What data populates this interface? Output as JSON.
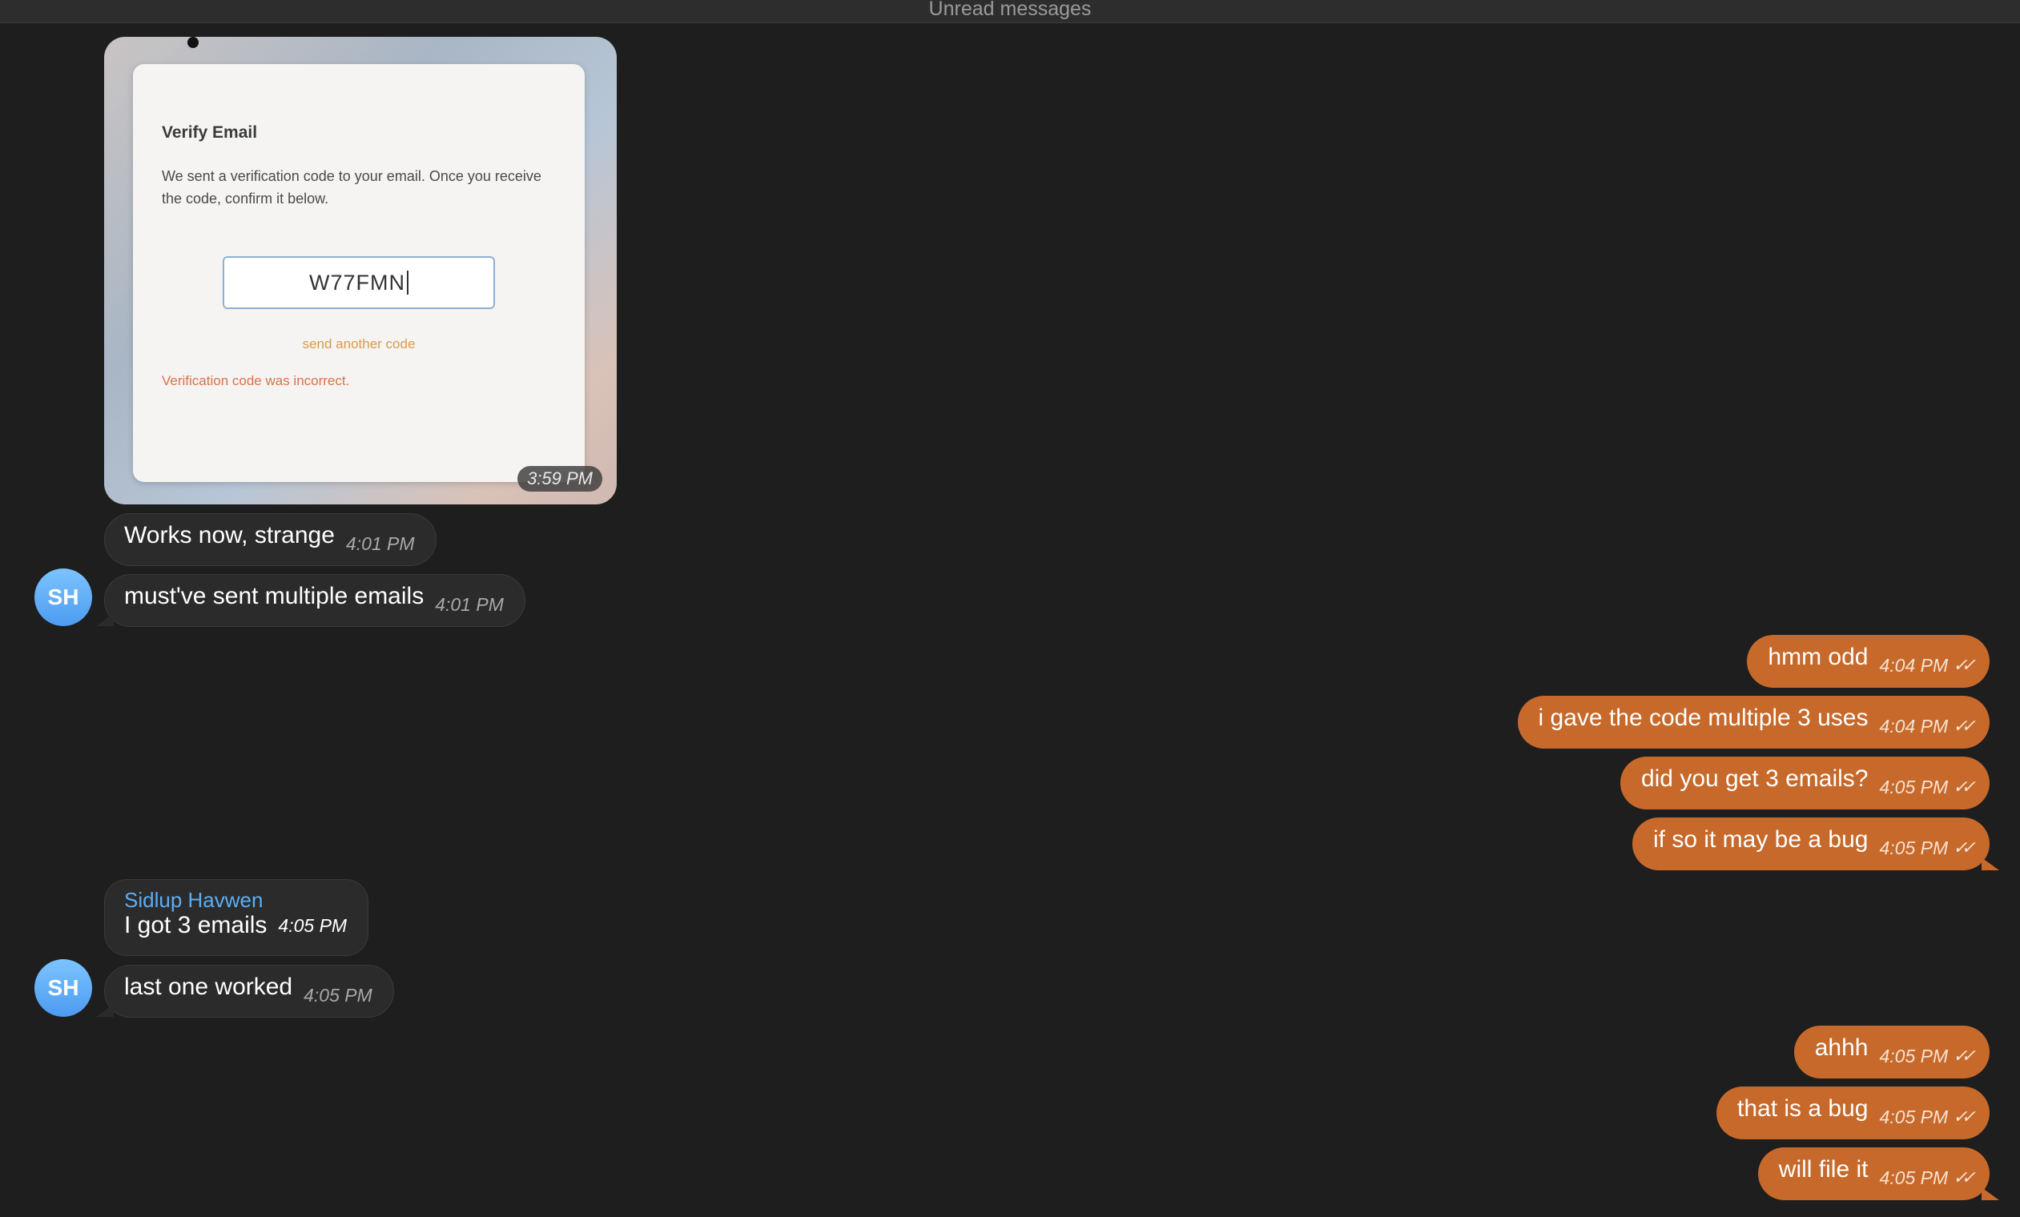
{
  "header": {
    "unread_label": "Unread messages"
  },
  "image_message": {
    "card_title": "Verify Email",
    "card_body": "We sent a verification code to your email. Once you receive the code, confirm it below.",
    "code_value": "W77FMN",
    "resend_link": "send another code",
    "error_text": "Verification code was incorrect.",
    "time": "3:59 PM"
  },
  "incoming_group1": [
    {
      "text": "Works now, strange",
      "time": "4:01 PM"
    },
    {
      "text": "must've sent multiple emails",
      "time": "4:01 PM"
    }
  ],
  "outgoing_group1": [
    {
      "text": "hmm odd",
      "time": "4:04 PM"
    },
    {
      "text": "i gave the code multiple 3 uses",
      "time": "4:04 PM"
    },
    {
      "text": "did you get 3 emails?",
      "time": "4:05 PM"
    },
    {
      "text": "if so it may be a bug",
      "time": "4:05 PM"
    }
  ],
  "incoming_group2": {
    "sender_name": "Sidlup Havwen",
    "messages": [
      {
        "text": "I got 3 emails",
        "time": "4:05 PM"
      },
      {
        "text": "last one worked",
        "time": "4:05 PM"
      }
    ]
  },
  "outgoing_group2": [
    {
      "text": "ahhh",
      "time": "4:05 PM"
    },
    {
      "text": "that is a bug",
      "time": "4:05 PM"
    },
    {
      "text": "will file it",
      "time": "4:05 PM"
    }
  ],
  "avatar": {
    "initials": "SH",
    "color": "#5aaef5"
  },
  "read_icon": "double-check-icon",
  "colors": {
    "outgoing_bubble": "#c7692a",
    "incoming_bubble": "#2b2b2b",
    "background": "#1e1e1e",
    "sender_name": "#5aaef5"
  }
}
